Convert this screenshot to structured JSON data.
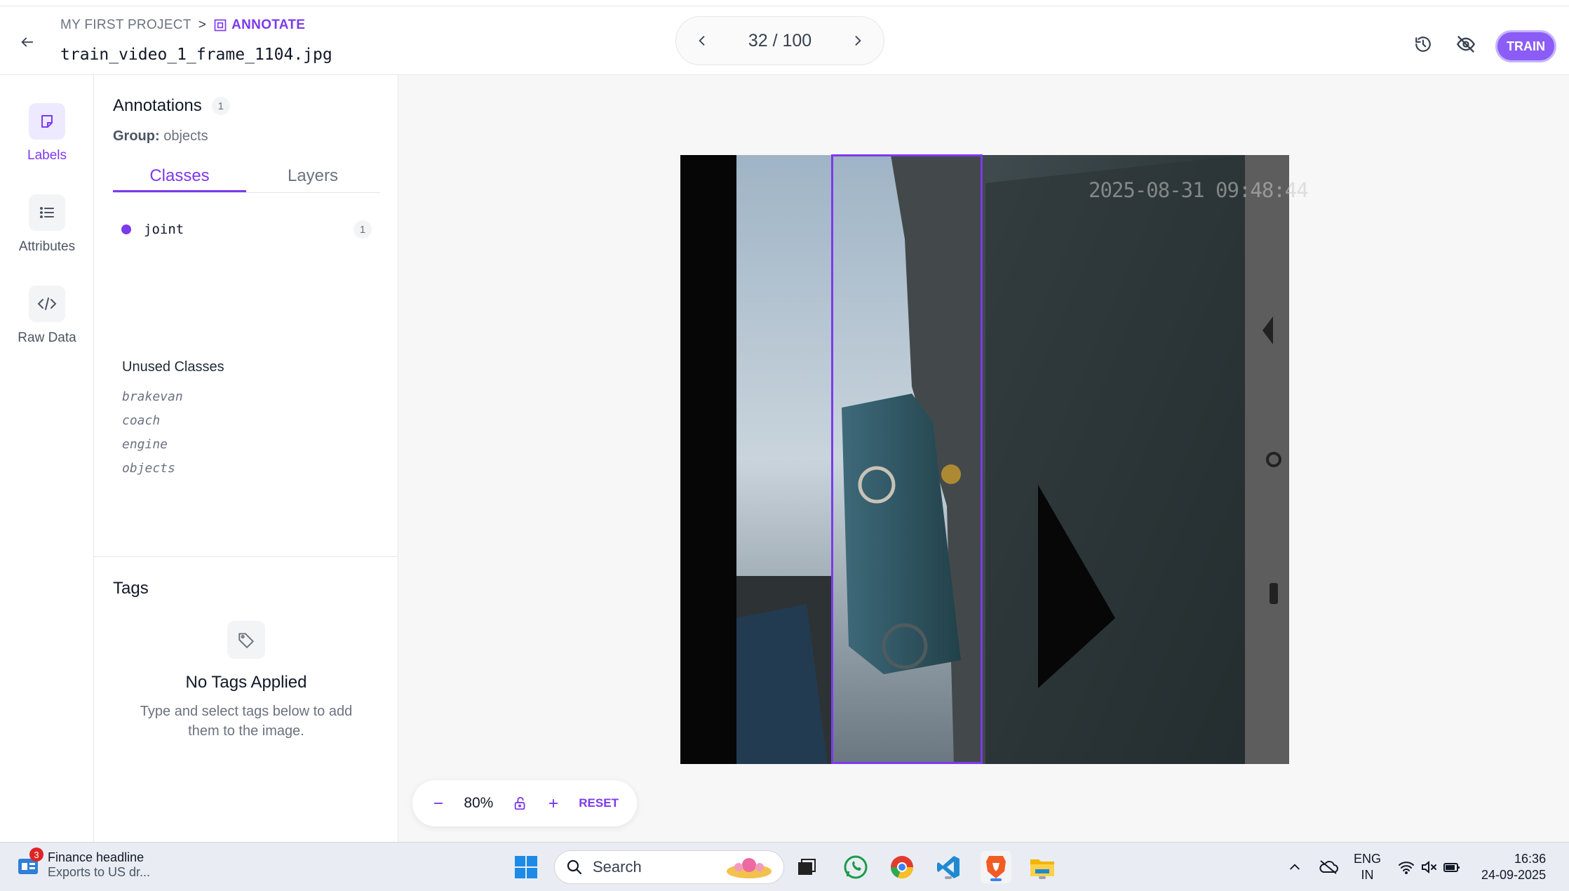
{
  "header": {
    "breadcrumb_project": "MY FIRST PROJECT",
    "breadcrumb_separator": ">",
    "breadcrumb_section": "ANNOTATE",
    "filename": "train_video_1_frame_1104.jpg",
    "pager_text": "32 / 100",
    "train_label": "TRAIN"
  },
  "rail": {
    "labels": "Labels",
    "attributes": "Attributes",
    "raw_data": "Raw Data"
  },
  "panel": {
    "annotations_title": "Annotations",
    "annotations_count": "1",
    "group_label": "Group:",
    "group_value": "objects",
    "tabs": [
      {
        "label": "Classes",
        "active": true
      },
      {
        "label": "Layers",
        "active": false
      }
    ],
    "classes": [
      {
        "name": "joint",
        "count": "1",
        "color": "#7c3aed"
      }
    ],
    "unused_title": "Unused Classes",
    "unused_classes": [
      "brakevan",
      "coach",
      "engine",
      "objects"
    ],
    "tags_title": "Tags",
    "no_tags_title": "No Tags Applied",
    "no_tags_sub": "Type and select tags below to add them to the image."
  },
  "canvas": {
    "image_timestamp": "2025-08-31 09:48:44",
    "zoom": "80%",
    "reset_label": "RESET"
  },
  "taskbar": {
    "news_badge": "3",
    "news_title": "Finance headline",
    "news_sub": "Exports to US dr...",
    "search_placeholder": "Search",
    "lang_top": "ENG",
    "lang_bottom": "IN",
    "time": "16:36",
    "date": "24-09-2025"
  },
  "colors": {
    "accent": "#7c3aed",
    "train_button": "#8b5cf6"
  }
}
